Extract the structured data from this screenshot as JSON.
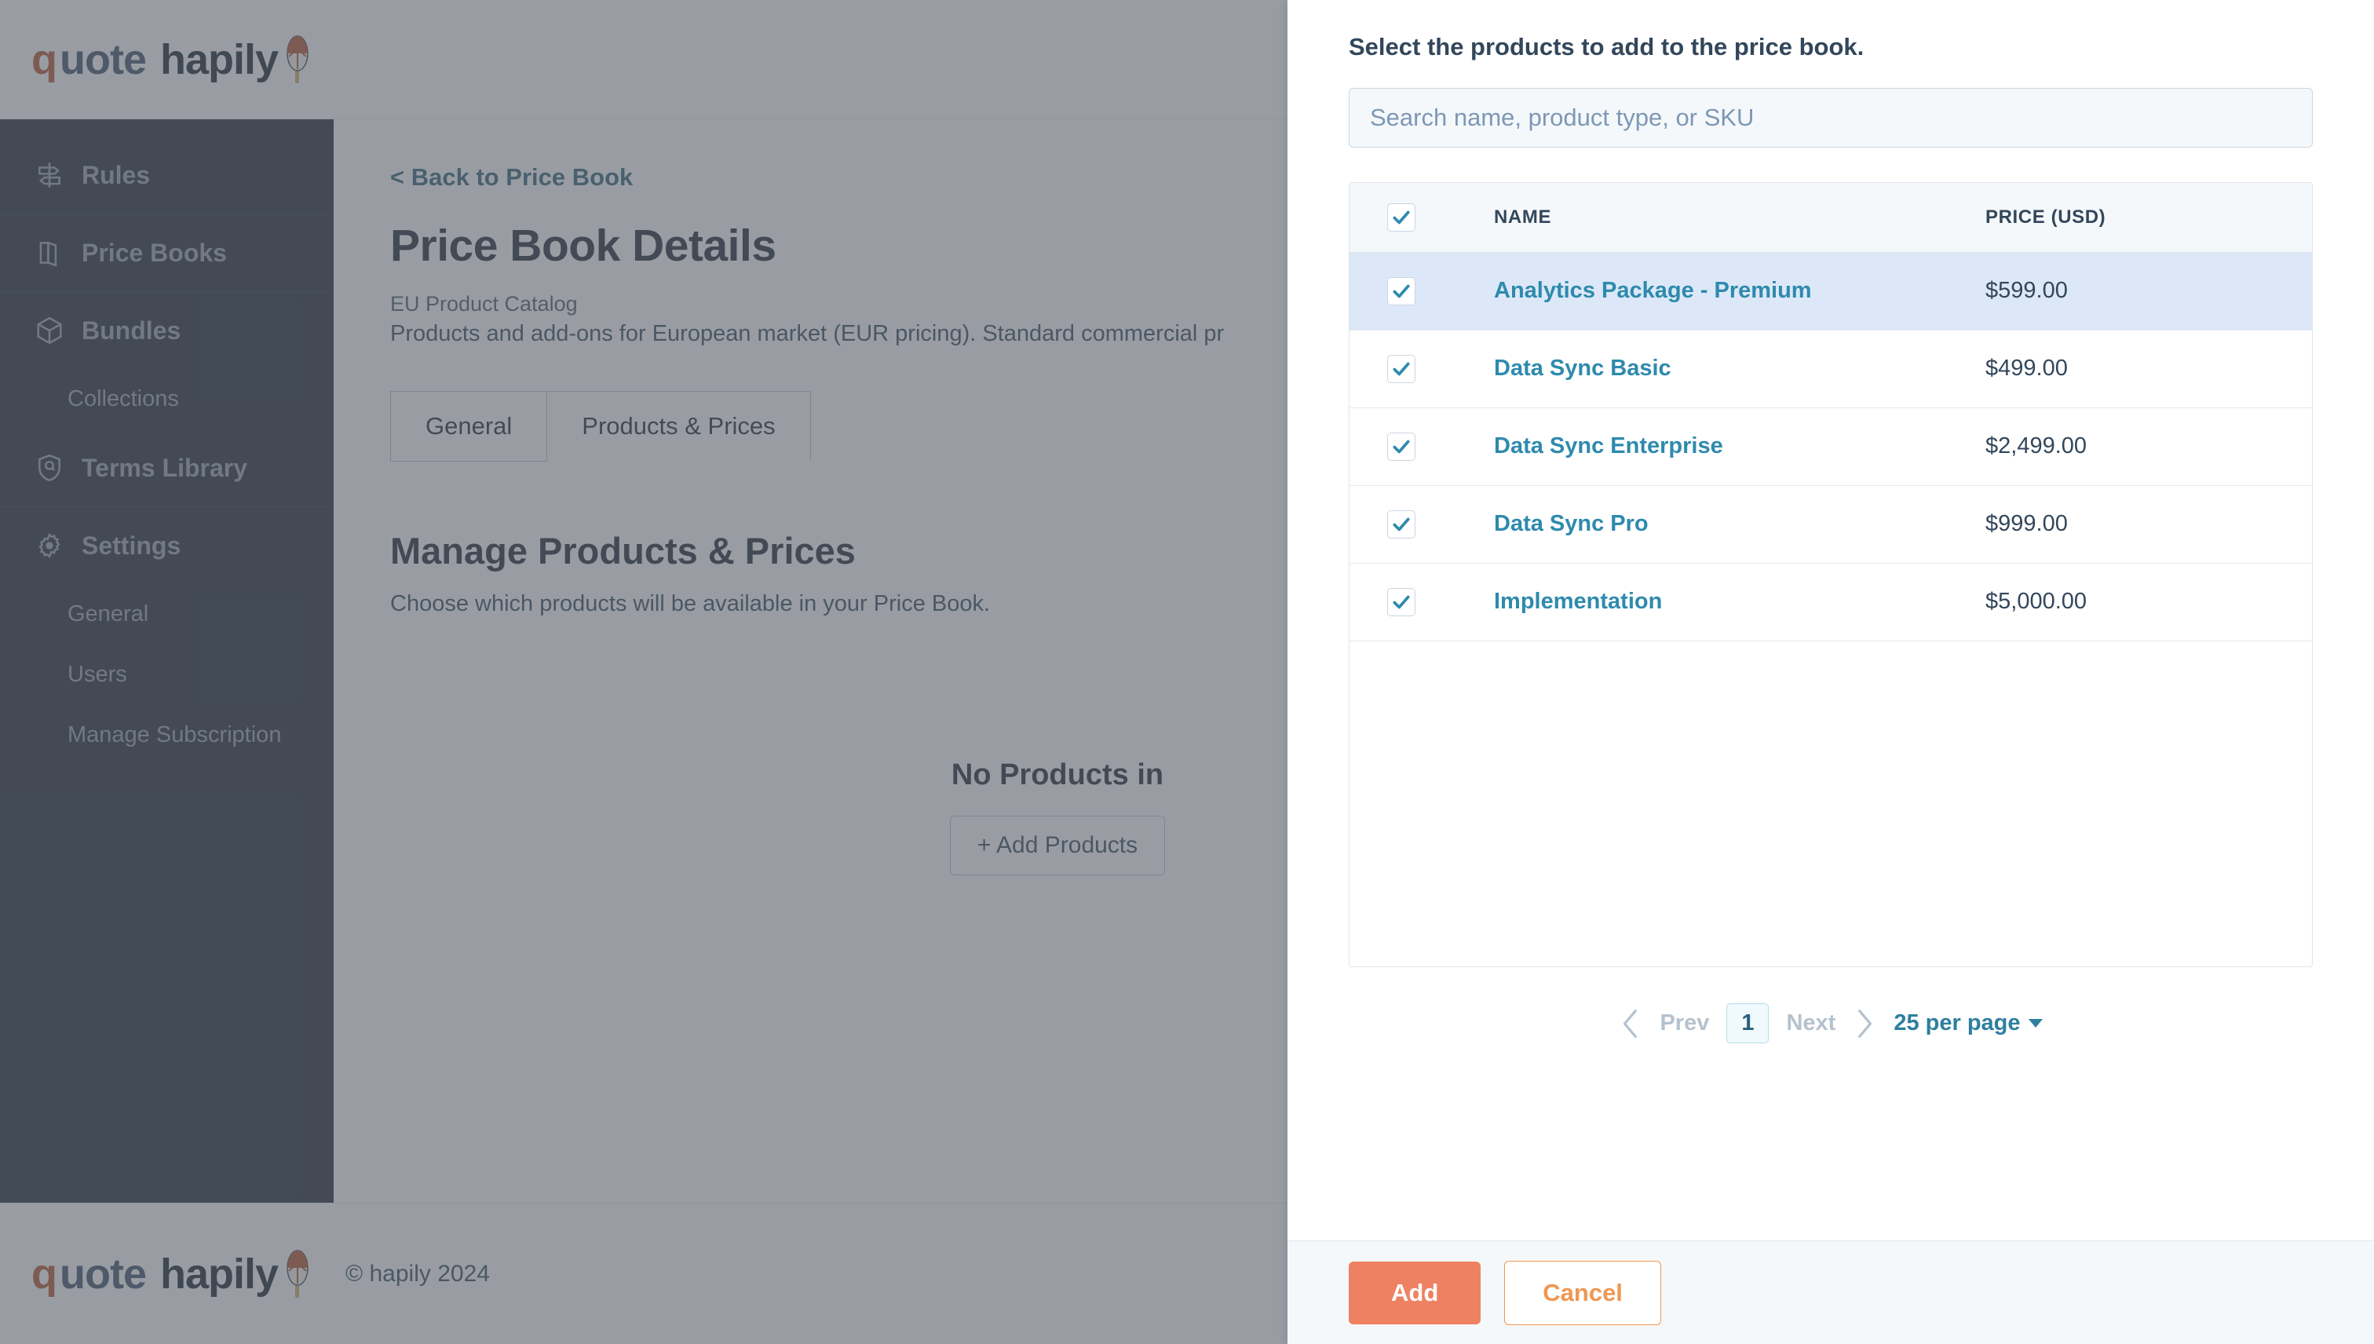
{
  "brand": {
    "logo_q": "q",
    "logo_uote": "uote",
    "logo_hapily": "hapily",
    "accent_orange": "#b5512e",
    "accent_navy": "#16242f"
  },
  "sidebar": {
    "items": [
      {
        "label": "Rules",
        "icon": "signpost-icon",
        "level": "top"
      },
      {
        "label": "Price Books",
        "icon": "book-icon",
        "level": "top"
      },
      {
        "label": "Bundles",
        "icon": "box-icon",
        "level": "top"
      },
      {
        "label": "Collections",
        "icon": "",
        "level": "sub"
      },
      {
        "label": "Terms Library",
        "icon": "shield-icon",
        "level": "top"
      },
      {
        "label": "Settings",
        "icon": "gear-icon",
        "level": "top"
      },
      {
        "label": "General",
        "icon": "",
        "level": "sub"
      },
      {
        "label": "Users",
        "icon": "",
        "level": "sub"
      },
      {
        "label": "Manage Subscription",
        "icon": "",
        "level": "sub"
      }
    ]
  },
  "main": {
    "back_link": "< Back to Price Book",
    "page_title": "Price Book Details",
    "price_book_name": "EU Product Catalog",
    "price_book_desc": "Products and add-ons for European market (EUR pricing). Standard commercial pr",
    "tabs": [
      {
        "label": "General",
        "active": false
      },
      {
        "label": "Products & Prices",
        "active": true
      }
    ],
    "section_title": "Manage Products & Prices",
    "section_sub": "Choose which products will be available in your Price Book.",
    "empty_title": "No Products in",
    "add_products_label": "+ Add Products"
  },
  "footer": {
    "copyright": "© hapily 2024"
  },
  "panel": {
    "title": "Select the products to add to the price book.",
    "search": {
      "value": "",
      "placeholder": "Search name, product type, or SKU"
    },
    "table": {
      "columns": [
        "",
        "NAME",
        "PRICE (USD)"
      ],
      "header_checkbox_checked": true,
      "rows": [
        {
          "checked": true,
          "name": "Analytics Package - Premium",
          "price": "$599.00",
          "selected": true
        },
        {
          "checked": true,
          "name": "Data Sync Basic",
          "price": "$499.00",
          "selected": false
        },
        {
          "checked": true,
          "name": "Data Sync Enterprise",
          "price": "$2,499.00",
          "selected": false
        },
        {
          "checked": true,
          "name": "Data Sync Pro",
          "price": "$999.00",
          "selected": false
        },
        {
          "checked": true,
          "name": "Implementation",
          "price": "$5,000.00",
          "selected": false
        }
      ]
    },
    "pagination": {
      "prev_label": "Prev",
      "current_page": "1",
      "next_label": "Next",
      "per_page_label": "25 per page"
    },
    "buttons": {
      "add": "Add",
      "cancel": "Cancel"
    }
  }
}
